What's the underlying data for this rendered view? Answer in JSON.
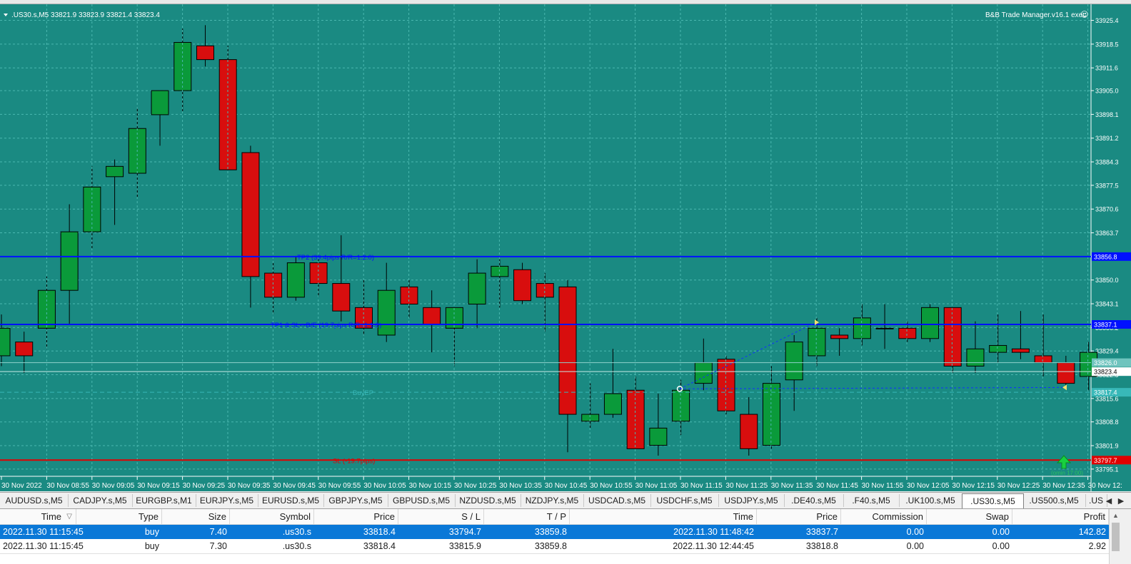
{
  "chart": {
    "symbol_info": ".US30.s,M5  33821.9 33823.9 33821.4 33823.4",
    "ea_label": "B&B Trade Manager.v16.1 exec",
    "ea_face": "☺",
    "price_min": 33793.0,
    "price_max": 33928.0,
    "price_ticks": [
      "33925.4",
      "33918.5",
      "33911.6",
      "33905.0",
      "33898.1",
      "33891.2",
      "33884.3",
      "33877.5",
      "33870.6",
      "33863.7",
      "33856.8",
      "33850.0",
      "33843.1",
      "33836.2",
      "33829.4",
      "33822.5",
      "33815.6",
      "33808.8",
      "33801.9",
      "33795.1"
    ],
    "time_labels": [
      "30 Nov 2022",
      "30 Nov 08:55",
      "30 Nov 09:05",
      "30 Nov 09:15",
      "30 Nov 09:25",
      "30 Nov 09:35",
      "30 Nov 09:45",
      "30 Nov 09:55",
      "30 Nov 10:05",
      "30 Nov 10:15",
      "30 Nov 10:25",
      "30 Nov 10:35",
      "30 Nov 10:45",
      "30 Nov 10:55",
      "30 Nov 11:05",
      "30 Nov 11:15",
      "30 Nov 11:25",
      "30 Nov 11:35",
      "30 Nov 11:45",
      "30 Nov 11:55",
      "30 Nov 12:05",
      "30 Nov 12:15",
      "30 Nov 12:25",
      "30 Nov 12:35",
      "30 Nov 12:"
    ],
    "candles": [
      {
        "o": 33828,
        "h": 33840,
        "l": 33825,
        "c": 33836
      },
      {
        "o": 33832,
        "h": 33835,
        "l": 33823,
        "c": 33828
      },
      {
        "o": 33836,
        "h": 33851,
        "l": 33830,
        "c": 33847
      },
      {
        "o": 33847,
        "h": 33872,
        "l": 33837,
        "c": 33864
      },
      {
        "o": 33864,
        "h": 33883,
        "l": 33859,
        "c": 33877
      },
      {
        "o": 33880,
        "h": 33885,
        "l": 33866,
        "c": 33883
      },
      {
        "o": 33881,
        "h": 33900,
        "l": 33874,
        "c": 33894
      },
      {
        "o": 33898,
        "h": 33902,
        "l": 33889,
        "c": 33905
      },
      {
        "o": 33905,
        "h": 33923,
        "l": 33899,
        "c": 33919
      },
      {
        "o": 33918,
        "h": 33924,
        "l": 33912,
        "c": 33914
      },
      {
        "o": 33914,
        "h": 33918,
        "l": 33885,
        "c": 33882
      },
      {
        "o": 33887,
        "h": 33889,
        "l": 33842,
        "c": 33851
      },
      {
        "o": 33852,
        "h": 33855,
        "l": 33840,
        "c": 33845
      },
      {
        "o": 33845,
        "h": 33857,
        "l": 33844,
        "c": 33855
      },
      {
        "o": 33855,
        "h": 33856,
        "l": 33845,
        "c": 33849
      },
      {
        "o": 33849,
        "h": 33863,
        "l": 33838,
        "c": 33841
      },
      {
        "o": 33842,
        "h": 33850,
        "l": 33834,
        "c": 33836
      },
      {
        "o": 33834,
        "h": 33855,
        "l": 33832,
        "c": 33847
      },
      {
        "o": 33848,
        "h": 33850,
        "l": 33839,
        "c": 33843
      },
      {
        "o": 33842,
        "h": 33847,
        "l": 33829,
        "c": 33837
      },
      {
        "o": 33836,
        "h": 33842,
        "l": 33825,
        "c": 33842
      },
      {
        "o": 33843,
        "h": 33856,
        "l": 33836,
        "c": 33852
      },
      {
        "o": 33851,
        "h": 33856,
        "l": 33842,
        "c": 33854
      },
      {
        "o": 33853,
        "h": 33855,
        "l": 33843,
        "c": 33844
      },
      {
        "o": 33849,
        "h": 33852,
        "l": 33835,
        "c": 33845
      },
      {
        "o": 33848,
        "h": 33850,
        "l": 33800,
        "c": 33811
      },
      {
        "o": 33809,
        "h": 33820,
        "l": 33807,
        "c": 33811
      },
      {
        "o": 33811,
        "h": 33830,
        "l": 33810,
        "c": 33817
      },
      {
        "o": 33818,
        "h": 33822,
        "l": 33801,
        "c": 33801
      },
      {
        "o": 33802,
        "h": 33817,
        "l": 33799,
        "c": 33807
      },
      {
        "o": 33809,
        "h": 33821,
        "l": 33805,
        "c": 33818
      },
      {
        "o": 33820,
        "h": 33833,
        "l": 33818,
        "c": 33826
      },
      {
        "o": 33827,
        "h": 33828,
        "l": 33811,
        "c": 33812
      },
      {
        "o": 33811,
        "h": 33816,
        "l": 33799,
        "c": 33801
      },
      {
        "o": 33802,
        "h": 33825,
        "l": 33801,
        "c": 33820
      },
      {
        "o": 33821,
        "h": 33834,
        "l": 33812,
        "c": 33832
      },
      {
        "o": 33828,
        "h": 33839,
        "l": 33825,
        "c": 33836
      },
      {
        "o": 33834,
        "h": 33836,
        "l": 33828,
        "c": 33833
      },
      {
        "o": 33833,
        "h": 33843,
        "l": 33831,
        "c": 33839
      },
      {
        "o": 33836,
        "h": 33843,
        "l": 33830,
        "c": 33836
      },
      {
        "o": 33836,
        "h": 33838,
        "l": 33832,
        "c": 33833
      },
      {
        "o": 33833,
        "h": 33843,
        "l": 33832,
        "c": 33842
      },
      {
        "o": 33842,
        "h": 33842,
        "l": 33823,
        "c": 33825
      },
      {
        "o": 33825,
        "h": 33838,
        "l": 33823,
        "c": 33830
      },
      {
        "o": 33829,
        "h": 33840,
        "l": 33826,
        "c": 33831
      },
      {
        "o": 33830,
        "h": 33841,
        "l": 33827,
        "c": 33829
      },
      {
        "o": 33828,
        "h": 33840,
        "l": 33822,
        "c": 33826
      },
      {
        "o": 33826,
        "h": 33828,
        "l": 33819,
        "c": 33820
      },
      {
        "o": 33822,
        "h": 33832,
        "l": 33818,
        "c": 33829
      }
    ],
    "lines": {
      "tp2": {
        "price": 33856.8,
        "label": "TP2 (39.4pips R/R=1:2.0)",
        "tag": "33856.8",
        "color": "#0010ff"
      },
      "tp1": {
        "price": 33837.1,
        "label": "TP1 & SL->B/E (19.7pips R/R=1:1.0)",
        "tag": "33837.1",
        "color": "#0010ff"
      },
      "sl": {
        "price": 33797.7,
        "label": "SL (-19.7pips)",
        "tag": "33797.7",
        "color": "#e00000"
      },
      "buy": {
        "price": 33817.4,
        "label": "BuyEP",
        "tag": "33817.4",
        "color": "#38b8b8"
      },
      "bid": {
        "price": 33823.4,
        "tag": "33823.4"
      },
      "ask": {
        "price": 33826.0,
        "tag": "33826.0"
      }
    },
    "corner_note": "(omin 17:00)",
    "colors": {
      "bg": "#1a8a82",
      "bull": "#0a9a3a",
      "bear": "#d80e0e",
      "grid": "#4bb8b0",
      "text": "#ffffff"
    }
  },
  "tabs": [
    {
      "label": "AUDUSD.s,M5",
      "w": 95
    },
    {
      "label": "CADJPY.s,M5",
      "w": 90
    },
    {
      "label": "EURGBP.s,M1",
      "w": 89
    },
    {
      "label": "EURJPY.s,M5",
      "w": 87
    },
    {
      "label": "EURUSD.s,M5",
      "w": 92
    },
    {
      "label": "GBPJPY.s,M5",
      "w": 90
    },
    {
      "label": "GBPUSD.s,M5",
      "w": 94
    },
    {
      "label": "NZDUSD.s,M5",
      "w": 92
    },
    {
      "label": "NZDJPY.s,M5",
      "w": 88
    },
    {
      "label": "USDCAD.s,M5",
      "w": 94
    },
    {
      "label": "USDCHF.s,M5",
      "w": 95
    },
    {
      "label": "USDJPY.s,M5",
      "w": 92
    },
    {
      "label": ".DE40.s,M5",
      "w": 83
    },
    {
      "label": ".F40.s,M5",
      "w": 78
    },
    {
      "label": ".UK100.s,M5",
      "w": 88
    },
    {
      "label": ".US30.s,M5",
      "w": 85,
      "active": true
    },
    {
      "label": ".US500.s,M5",
      "w": 88
    },
    {
      "label": ".US",
      "w": 30
    }
  ],
  "tab_arrows": {
    "left": "◀",
    "right": "▶"
  },
  "table": {
    "headers": [
      "Time",
      "Type",
      "Size",
      "Symbol",
      "Price",
      "S / L",
      "T / P",
      "Time",
      "Price",
      "Commission",
      "Swap",
      "Profit"
    ],
    "sort_icon": "▽",
    "rows": [
      [
        "2022.11.30 11:15:45",
        "buy",
        "7.40",
        ".us30.s",
        "33818.4",
        "33794.7",
        "33859.8",
        "2022.11.30 11:48:42",
        "33837.7",
        "0.00",
        "0.00",
        "142.82"
      ],
      [
        "2022.11.30 11:15:45",
        "buy",
        "7.30",
        ".us30.s",
        "33818.4",
        "33815.9",
        "33859.8",
        "2022.11.30 12:44:45",
        "33818.8",
        "0.00",
        "0.00",
        "2.92"
      ]
    ]
  },
  "scrollbar": {
    "up": "▲"
  }
}
